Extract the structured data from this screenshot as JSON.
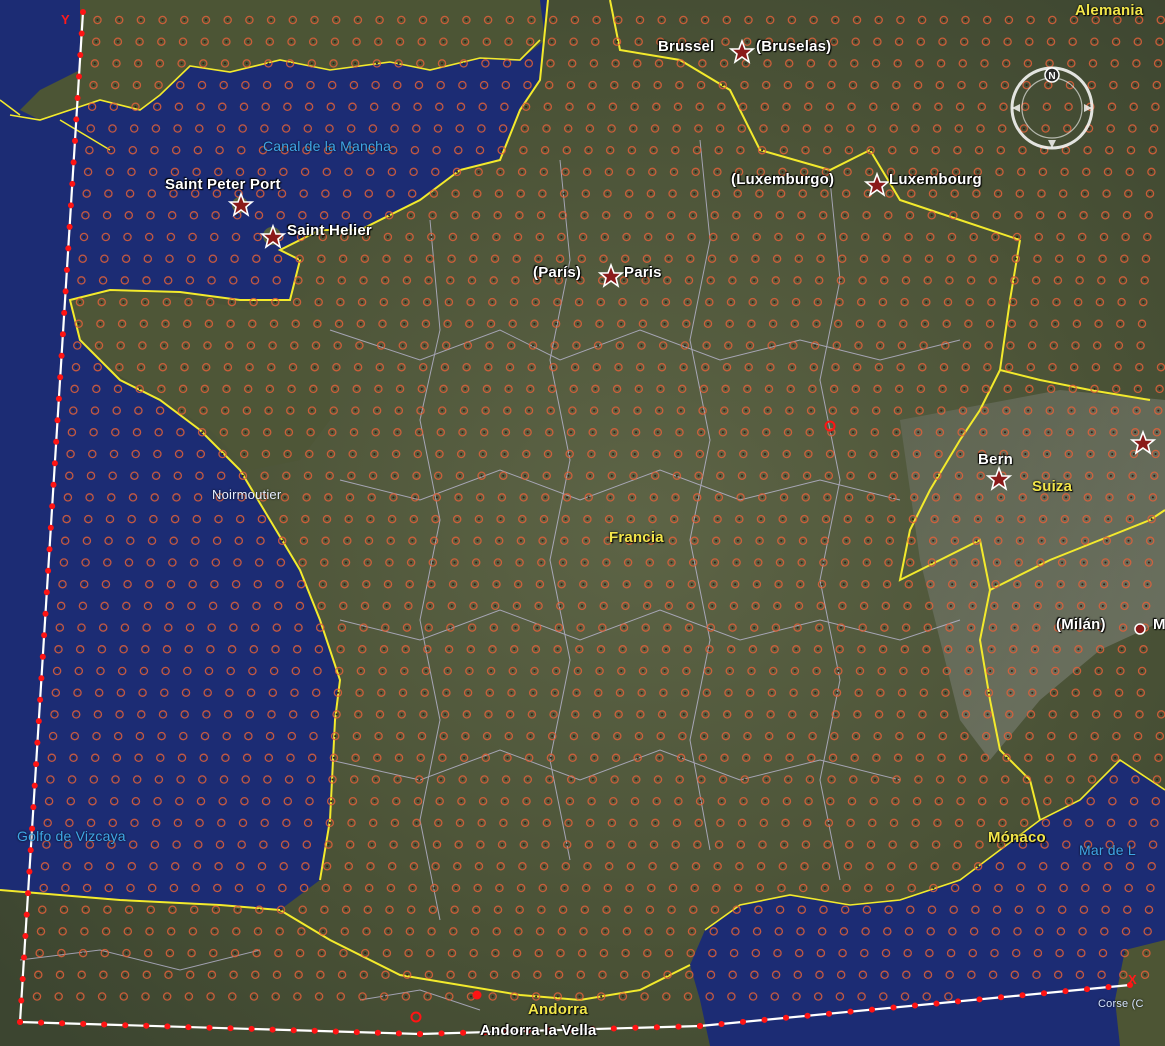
{
  "map": {
    "labels": {
      "alemania": "Alemania",
      "brussel": "Brussel",
      "bruselas": "(Bruselas)",
      "canal": "Canal de la Mancha",
      "saint_peter_port": "Saint Peter Port",
      "saint_helier": "Saint Helier",
      "luxemburgo": "(Luxemburgo)",
      "luxembourg": "Luxembourg",
      "paris_es": "(París)",
      "paris": "Paris",
      "bern": "Bern",
      "suiza": "Suiza",
      "noirmoutier": "Noirmoutier",
      "francia": "Francia",
      "milan": "(Milán)",
      "milan_cut": "M",
      "golfo": "Golfo de Vizcaya",
      "monaco": "Mónaco",
      "mar": "Mar de L",
      "andorra": "Andorra",
      "andorra_vella": "Andorra la Vella",
      "corse": "Corse (C",
      "axis_y": "Y",
      "axis_x": "X"
    },
    "compass_letter": "N",
    "colors": {
      "sea": "#1c2c74",
      "land": "#4f5a3a",
      "border_country": "#f3ea2c",
      "border_region": "#c9c4e6",
      "grid_point": "#e0603a",
      "domain_line": "#ffffff",
      "domain_point": "#ff1414"
    }
  }
}
